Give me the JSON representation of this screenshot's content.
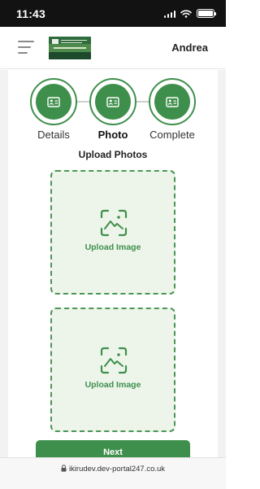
{
  "status_bar": {
    "time": "11:43"
  },
  "header": {
    "user_name": "Andrea"
  },
  "stepper": {
    "steps": [
      {
        "label": "Details",
        "state": "completed",
        "icon": "id-card-icon"
      },
      {
        "label": "Photo",
        "state": "active",
        "icon": "id-card-icon"
      },
      {
        "label": "Complete",
        "state": "pending",
        "icon": "id-card-icon"
      }
    ]
  },
  "section": {
    "title": "Upload Photos"
  },
  "uploads": [
    {
      "label": "Upload Image",
      "icon": "image-scan-icon"
    },
    {
      "label": "Upload Image",
      "icon": "image-scan-icon"
    }
  ],
  "actions": {
    "next_label": "Next"
  },
  "browser": {
    "url": "ikirudev.dev-portal247.co.uk"
  },
  "colors": {
    "accent": "#3f8f4c",
    "upload_bg": "#edf5ea",
    "status_bar": "#121212"
  }
}
